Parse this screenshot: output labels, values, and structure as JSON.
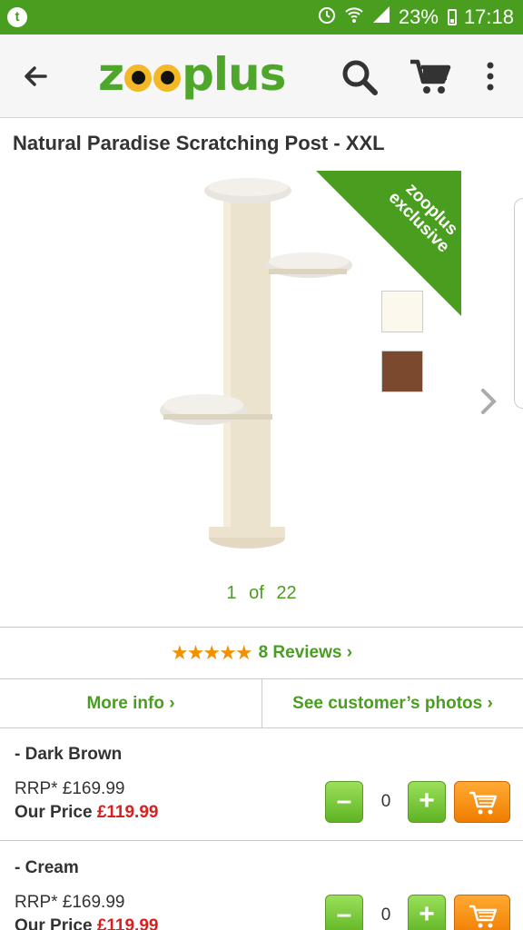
{
  "status_bar": {
    "app_badge": "t",
    "battery": "23%",
    "time": "17:18"
  },
  "app_bar": {
    "logo_left": "z",
    "logo_right": "plus",
    "icons": [
      "back-arrow-icon",
      "search-icon",
      "cart-icon",
      "more-vert-icon"
    ]
  },
  "product": {
    "title": "Natural Paradise Scratching Post - XXL",
    "ribbon_line1": "zooplus",
    "ribbon_line2": "exclusive",
    "swatches": [
      {
        "name": "Cream",
        "color": "#fdf8ee"
      },
      {
        "name": "Dark Brown",
        "color": "#7b4a2e"
      }
    ],
    "pager": "1 of 22"
  },
  "reviews": {
    "stars": "★★★★★",
    "label": "8 Reviews ›"
  },
  "info": {
    "more_info": "More info ›",
    "customer_photos": "See customer’s photos ›"
  },
  "variants": [
    {
      "name": "- Dark Brown",
      "rrp": "RRP* £169.99",
      "our_label": "Our Price ",
      "our_price": "£119.99",
      "qty": "0"
    },
    {
      "name": "- Cream",
      "rrp": "RRP* £169.99",
      "our_label": "Our Price ",
      "our_price": "£119.99",
      "qty": "0"
    }
  ],
  "colors": {
    "brand_green": "#4a9e1f",
    "price_red": "#d92020",
    "cart_orange": "#f07d00",
    "star_orange": "#f29100"
  }
}
